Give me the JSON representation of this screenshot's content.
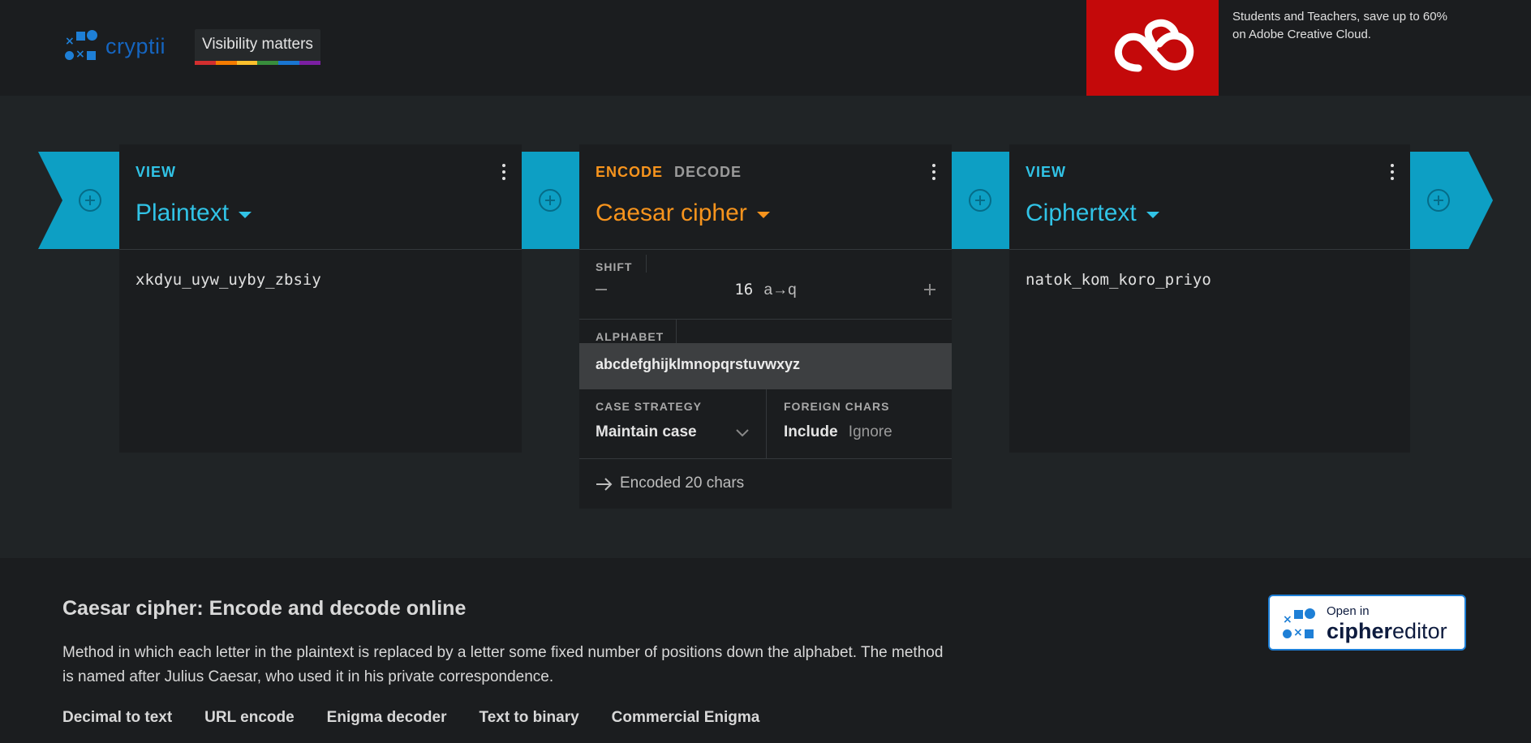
{
  "header": {
    "logo_text": "cryptii",
    "visibility_label": "Visibility matters",
    "rainbow": [
      "#d32f2f",
      "#f57c00",
      "#fbc02d",
      "#388e3c",
      "#1976d2",
      "#7b1fa2"
    ]
  },
  "ad": {
    "text": "Students and Teachers, save up to 60% on Adobe Creative Cloud.",
    "brand_color": "#c4090a"
  },
  "bricks": {
    "left_view": {
      "tab": "VIEW",
      "title": "Plaintext",
      "content": "xkdyu_uyw_uyby_zbsiy"
    },
    "encoder": {
      "tab_encode": "ENCODE",
      "tab_decode": "DECODE",
      "title": "Caesar cipher",
      "shift_label": "SHIFT",
      "shift_value": "16",
      "shift_mapping": "a→q",
      "alphabet_label": "ALPHABET",
      "alphabet_value": "abcdefghijklmnopqrstuvwxyz",
      "case_label": "CASE STRATEGY",
      "case_value": "Maintain case",
      "foreign_label": "FOREIGN CHARS",
      "foreign_include": "Include",
      "foreign_ignore": "Ignore",
      "status": "Encoded 20 chars"
    },
    "right_view": {
      "tab": "VIEW",
      "title": "Ciphertext",
      "content": "natok_kom_koro_priyo"
    }
  },
  "footer": {
    "heading": "Caesar cipher: Encode and decode online",
    "description": "Method in which each letter in the plaintext is replaced by a letter some fixed number of positions down the alphabet. The method is named after Julius Caesar, who used it in his private correspondence.",
    "links": [
      "Decimal to text",
      "URL encode",
      "Enigma decoder",
      "Text to binary",
      "Commercial Enigma"
    ],
    "cipher_editor": {
      "open_in": "Open in",
      "brand_bold": "cipher",
      "brand_regular": "editor"
    }
  },
  "colors": {
    "accent_cyan": "#31c3e6",
    "accent_orange": "#f7941d",
    "pipe_blue": "#0d9fc4"
  }
}
